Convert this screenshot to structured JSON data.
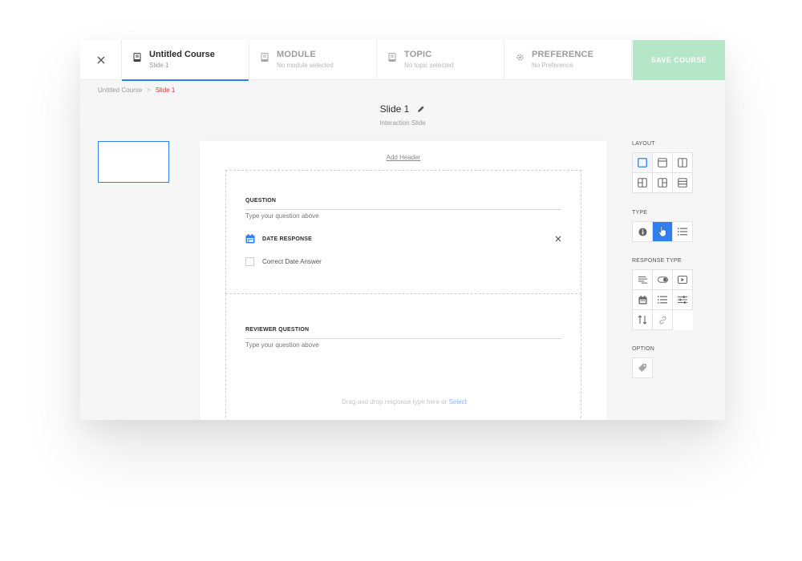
{
  "topbar": {
    "steps": [
      {
        "title": "Untitled Course",
        "subtitle": "Slide 1"
      },
      {
        "title": "MODULE",
        "subtitle": "No module selected"
      },
      {
        "title": "TOPIC",
        "subtitle": "No topic selected"
      },
      {
        "title": "PREFERENCE",
        "subtitle": "No Preference"
      }
    ],
    "save_label": "SAVE COURSE"
  },
  "breadcrumb": {
    "items": [
      "Untitled Course",
      "Slide 1"
    ],
    "separator": ">"
  },
  "slide": {
    "name": "Slide 1",
    "type": "Interaction Slide"
  },
  "canvas": {
    "add_header": "Add Header",
    "question": {
      "label": "QUESTION",
      "placeholder": "Type your question above"
    },
    "response": {
      "label": "DATE RESPONSE",
      "checkbox_label": "Correct Date Answer"
    },
    "reviewer": {
      "label": "REVIEWER QUESTION",
      "placeholder": "Type your question above",
      "drop_hint": "Drag and drop response type here or",
      "select_link": "Select"
    }
  },
  "panel": {
    "layout_heading": "LAYOUT",
    "type_heading": "TYPE",
    "response_type_heading": "RESPONSE TYPE",
    "option_heading": "OPTION"
  },
  "colors": {
    "accent": "#2f80ed",
    "save": "#b5e6c8",
    "breadcrumb_current": "#d83a3a"
  }
}
